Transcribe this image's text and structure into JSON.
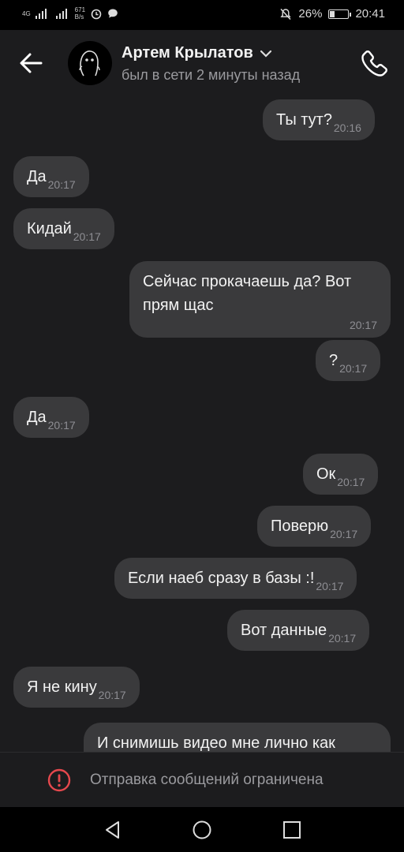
{
  "status_bar": {
    "network_label": "4G",
    "speed_value": "671",
    "speed_unit": "B/s",
    "battery_percent": "26%",
    "battery_level": 0.26,
    "time": "20:41"
  },
  "header": {
    "contact_name": "Артем Крылатов",
    "last_seen": "был в сети 2 минуты назад"
  },
  "messages": [
    {
      "direction": "out",
      "text": "Ты тут?",
      "time": "20:16"
    },
    {
      "direction": "in",
      "text": "Да",
      "time": "20:17"
    },
    {
      "direction": "in",
      "text": "Кидай",
      "time": "20:17"
    },
    {
      "direction": "out",
      "text": "Сейчас прокачаешь да? Вот прям щас",
      "time": "20:17"
    },
    {
      "direction": "out",
      "text": "?",
      "time": "20:17"
    },
    {
      "direction": "in",
      "text": "Да",
      "time": "20:17"
    },
    {
      "direction": "out",
      "text": "Ок",
      "time": "20:17"
    },
    {
      "direction": "out",
      "text": "Поверю",
      "time": "20:17"
    },
    {
      "direction": "out",
      "text": "Если наеб сразу в базы :!",
      "time": "20:17"
    },
    {
      "direction": "out",
      "text": "Вот данные",
      "time": "20:17"
    },
    {
      "direction": "in",
      "text": "Я не кину",
      "time": "20:17"
    },
    {
      "direction": "out",
      "text": "И снимишь видео мне лично как",
      "time": ""
    }
  ],
  "footer": {
    "restriction_text": "Отправка сообщений ограничена"
  },
  "icons": {
    "back": "arrow-left-icon",
    "call": "phone-icon",
    "dropdown": "chevron-down-icon",
    "restricted": "exclamation-circle-icon",
    "nav_back": "triangle-back-icon",
    "nav_home": "circle-home-icon",
    "nav_recents": "square-recents-icon"
  },
  "colors": {
    "background": "#1c1c1e",
    "bubble": "#3a3a3c",
    "time": "#8e8e93",
    "alert_red": "#e5484d"
  }
}
